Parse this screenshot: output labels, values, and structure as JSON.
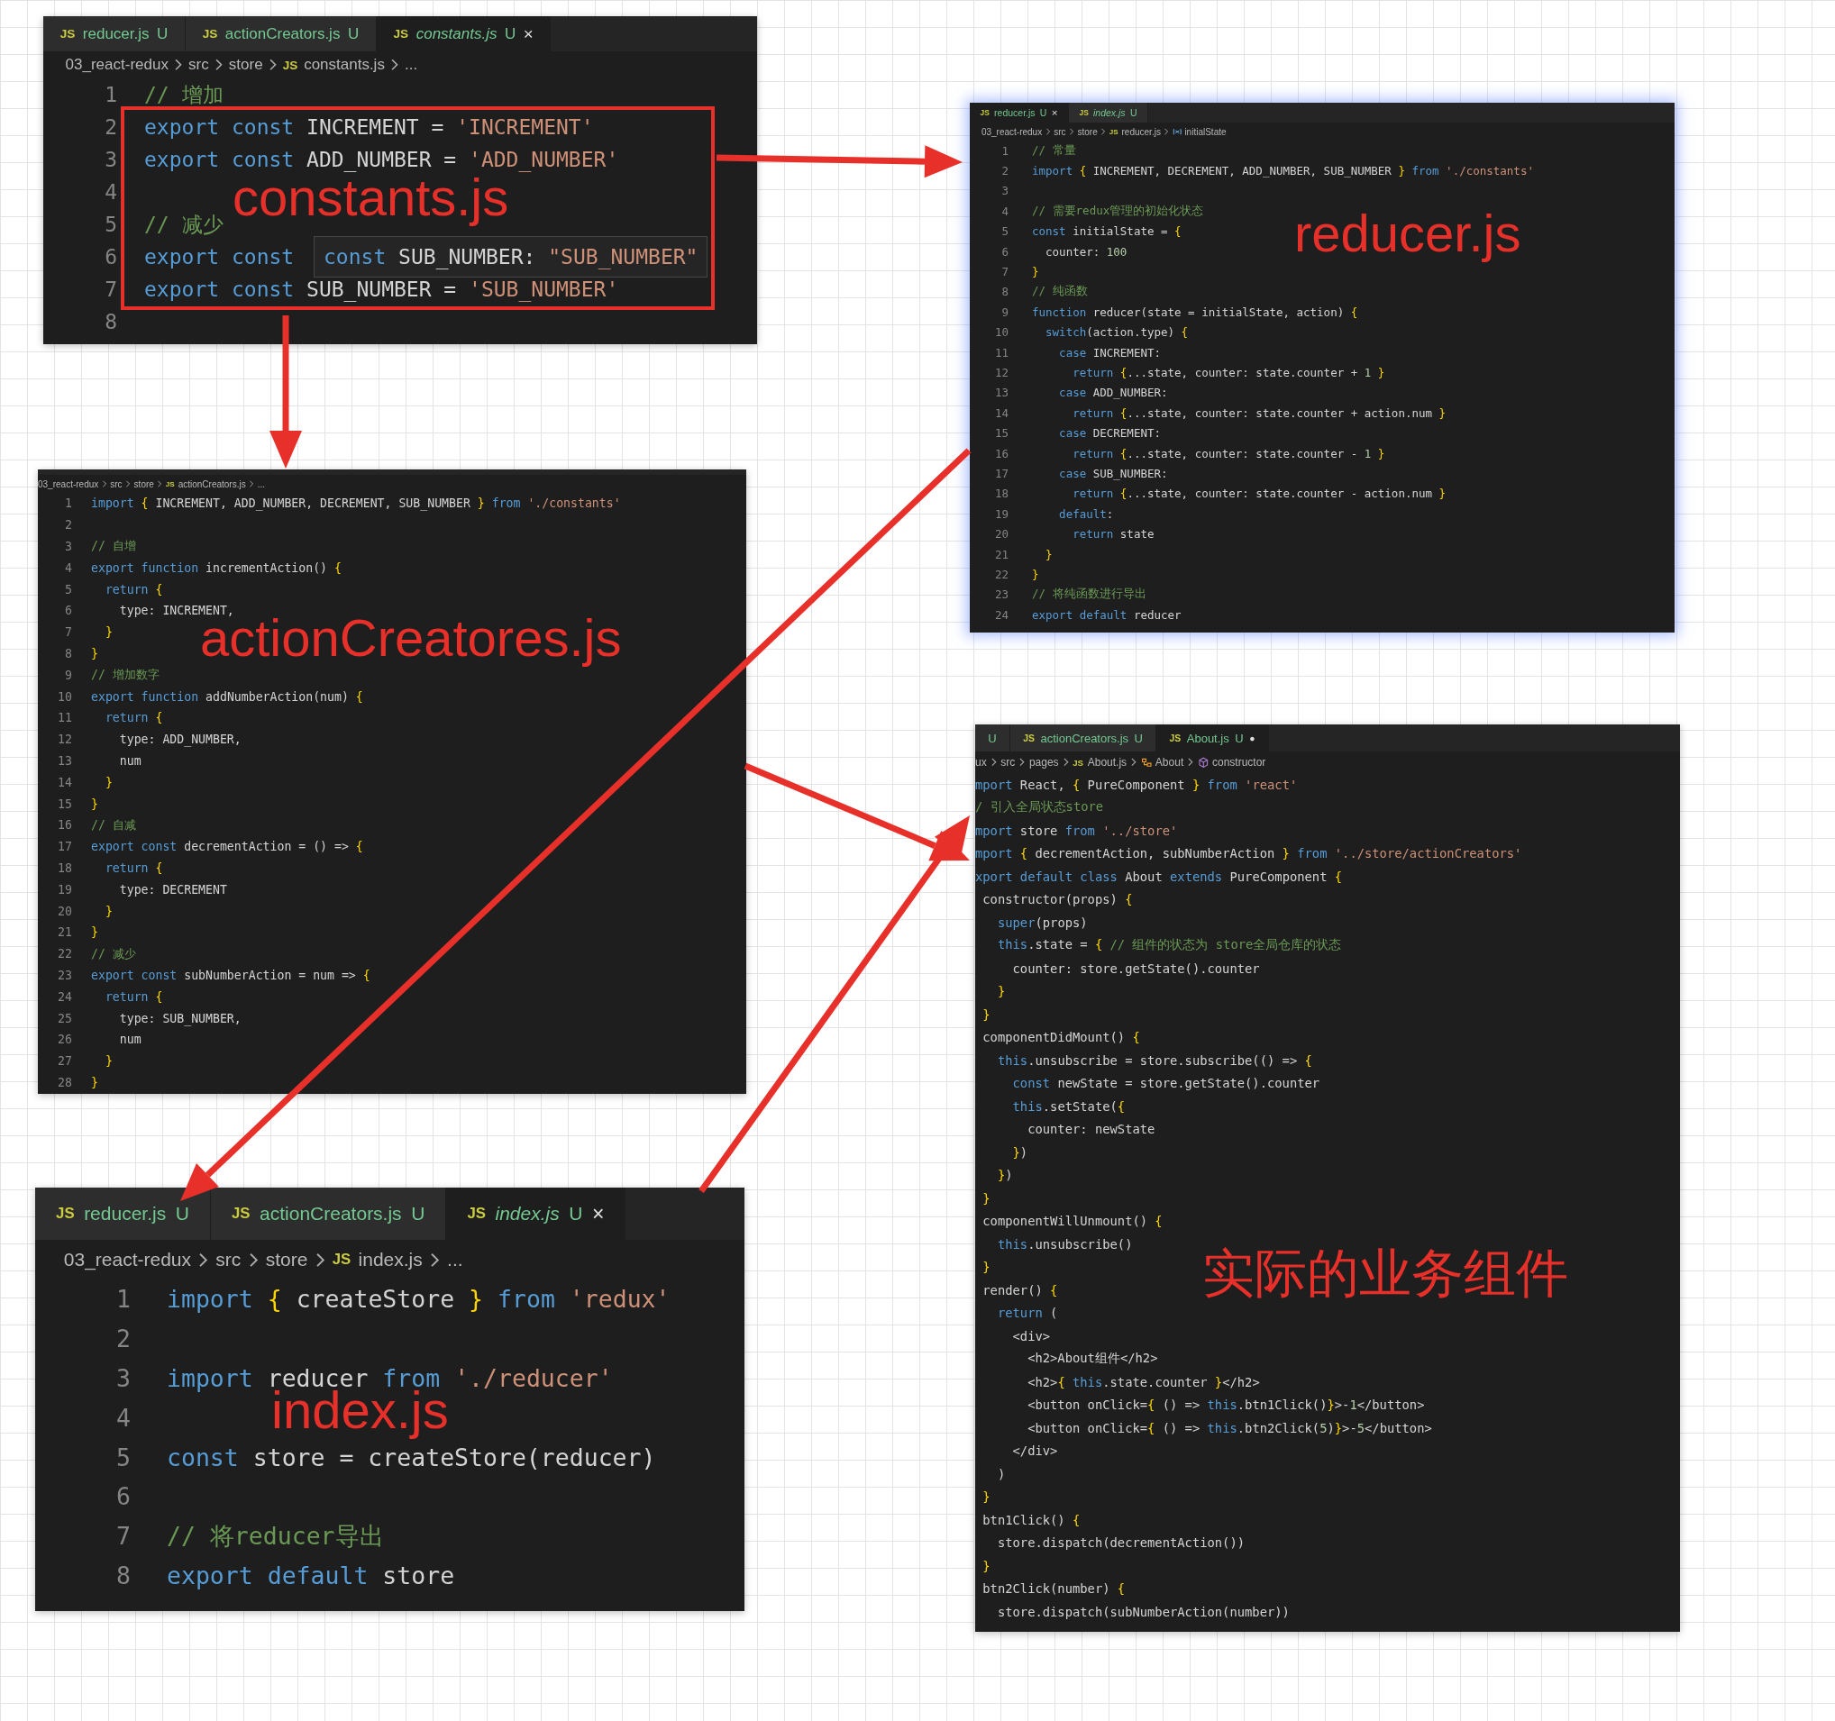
{
  "editors": [
    {
      "tabs": [
        {
          "icon": "JS",
          "label": "reducer.js",
          "badge": "U",
          "selected": false,
          "preview": false
        },
        {
          "icon": "JS",
          "label": "actionCreators.js",
          "badge": "U",
          "selected": false,
          "preview": false
        },
        {
          "icon": "JS",
          "label": "constants.js",
          "badge": "U",
          "close": "×",
          "selected": true,
          "preview": true
        }
      ],
      "breadcrumb": [
        {
          "text": "03_react-redux"
        },
        {
          "text": "src"
        },
        {
          "text": "store"
        },
        {
          "icon": "JS",
          "text": "constants.js"
        },
        {
          "text": "..."
        }
      ],
      "lines": [
        {
          "n": "1",
          "code": "// 增加"
        },
        {
          "n": "2",
          "code": "export const INCREMENT = 'INCREMENT'"
        },
        {
          "n": "3",
          "code": "export const ADD_NUMBER = 'ADD_NUMBER'"
        },
        {
          "n": "4"
        },
        {
          "n": "5",
          "code": "// 减少"
        },
        {
          "n": "6",
          "code": "export const"
        },
        {
          "n": "7",
          "code": "export const SUB_NUMBER = 'SUB_NUMBER'"
        },
        {
          "n": "8"
        }
      ],
      "tooltip": "const SUB_NUMBER: \"SUB_NUMBER\"",
      "annotation": "constants.js"
    },
    {
      "tabs": [
        {
          "icon": "JS",
          "label": "reducer.js",
          "badge": "U",
          "close": "×",
          "selected": true,
          "preview": false
        },
        {
          "icon": "JS",
          "label": "index.js",
          "badge": "U",
          "selected": false,
          "preview": true
        }
      ],
      "breadcrumb": [
        {
          "text": "03_react-redux"
        },
        {
          "text": "src"
        },
        {
          "text": "store"
        },
        {
          "icon": "JS",
          "text": "reducer.js"
        },
        {
          "kind": "variable",
          "text": "initialState"
        }
      ],
      "lines": [
        {
          "n": "1",
          "code": "// 常量"
        },
        {
          "n": "2",
          "code": "import { INCREMENT, DECREMENT, ADD_NUMBER, SUB_NUMBER } from './constants'"
        },
        {
          "n": "3"
        },
        {
          "n": "4",
          "code": "// 需要redux管理的初始化状态"
        },
        {
          "n": "5",
          "code": "const initialState = {"
        },
        {
          "n": "6",
          "code": "  counter: 100"
        },
        {
          "n": "7",
          "code": "}"
        },
        {
          "n": "8",
          "code": "// 纯函数"
        },
        {
          "n": "9",
          "code": "function reducer(state = initialState, action) {"
        },
        {
          "n": "10",
          "code": "  switch(action.type) {"
        },
        {
          "n": "11",
          "code": "    case INCREMENT:"
        },
        {
          "n": "12",
          "code": "      return {...state, counter: state.counter + 1 }"
        },
        {
          "n": "13",
          "code": "    case ADD_NUMBER:"
        },
        {
          "n": "14",
          "code": "      return {...state, counter: state.counter + action.num }"
        },
        {
          "n": "15",
          "code": "    case DECREMENT:"
        },
        {
          "n": "16",
          "code": "      return {...state, counter: state.counter - 1 }"
        },
        {
          "n": "17",
          "code": "    case SUB_NUMBER:"
        },
        {
          "n": "18",
          "code": "      return {...state, counter: state.counter - action.num }"
        },
        {
          "n": "19",
          "code": "    default:"
        },
        {
          "n": "20",
          "code": "      return state"
        },
        {
          "n": "21",
          "code": "  }"
        },
        {
          "n": "22",
          "code": "}"
        },
        {
          "n": "23",
          "code": "// 将纯函数进行导出"
        },
        {
          "n": "24",
          "code": "export default reducer"
        }
      ],
      "annotation": "reducer.js"
    },
    {
      "breadcrumb": [
        {
          "text": "03_react-redux"
        },
        {
          "text": "src"
        },
        {
          "text": "store"
        },
        {
          "icon": "JS",
          "text": "actionCreators.js"
        },
        {
          "text": "..."
        }
      ],
      "lines": [
        {
          "n": "1",
          "code": "import { INCREMENT, ADD_NUMBER, DECREMENT, SUB_NUMBER } from './constants'"
        },
        {
          "n": "2"
        },
        {
          "n": "3",
          "code": "// 自增"
        },
        {
          "n": "4",
          "code": "export function incrementAction() {"
        },
        {
          "n": "5",
          "code": "  return {"
        },
        {
          "n": "6",
          "code": "    type: INCREMENT,"
        },
        {
          "n": "7",
          "code": "  }"
        },
        {
          "n": "8",
          "code": "}"
        },
        {
          "n": "9",
          "code": "// 增加数字"
        },
        {
          "n": "10",
          "code": "export function addNumberAction(num) {"
        },
        {
          "n": "11",
          "code": "  return {"
        },
        {
          "n": "12",
          "code": "    type: ADD_NUMBER,"
        },
        {
          "n": "13",
          "code": "    num"
        },
        {
          "n": "14",
          "code": "  }"
        },
        {
          "n": "15",
          "code": "}"
        },
        {
          "n": "16",
          "code": "// 自减"
        },
        {
          "n": "17",
          "code": "export const decrementAction = () => {"
        },
        {
          "n": "18",
          "code": "  return {"
        },
        {
          "n": "19",
          "code": "    type: DECREMENT"
        },
        {
          "n": "20",
          "code": "  }"
        },
        {
          "n": "21",
          "code": "}"
        },
        {
          "n": "22",
          "code": "// 减少"
        },
        {
          "n": "23",
          "code": "export const subNumberAction = num => {"
        },
        {
          "n": "24",
          "code": "  return {"
        },
        {
          "n": "25",
          "code": "    type: SUB_NUMBER,"
        },
        {
          "n": "26",
          "code": "    num"
        },
        {
          "n": "27",
          "code": "  }"
        },
        {
          "n": "28",
          "code": "}"
        }
      ],
      "annotation": "actionCreatores.js"
    },
    {
      "tabs": [
        {
          "icon": "JS",
          "label": "reducer.js",
          "badge": "U",
          "selected": false,
          "preview": false
        },
        {
          "icon": "JS",
          "label": "actionCreators.js",
          "badge": "U",
          "selected": false,
          "preview": false
        },
        {
          "icon": "JS",
          "label": "index.js",
          "badge": "U",
          "close": "×",
          "selected": true,
          "preview": true
        }
      ],
      "breadcrumb": [
        {
          "text": "03_react-redux"
        },
        {
          "text": "src"
        },
        {
          "text": "store"
        },
        {
          "icon": "JS",
          "text": "index.js"
        },
        {
          "text": "..."
        }
      ],
      "lines": [
        {
          "n": "1",
          "code": "import { createStore } from 'redux'"
        },
        {
          "n": "2"
        },
        {
          "n": "3",
          "code": "import reducer from './reducer'"
        },
        {
          "n": "4"
        },
        {
          "n": "5",
          "code": "const store = createStore(reducer)"
        },
        {
          "n": "6"
        },
        {
          "n": "7",
          "code": "// 将reducer导出"
        },
        {
          "n": "8",
          "code": "export default store"
        }
      ],
      "annotation": "index.js"
    },
    {
      "tabs": [
        {
          "badge": "U",
          "selected": false
        },
        {
          "icon": "JS",
          "label": "actionCreators.js",
          "badge": "U",
          "selected": false,
          "preview": false
        },
        {
          "icon": "JS",
          "label": "About.js",
          "badge": "U",
          "dirty": "●",
          "selected": true,
          "preview": false
        }
      ],
      "breadcrumb": [
        {
          "text": "ux"
        },
        {
          "text": "src"
        },
        {
          "text": "pages"
        },
        {
          "icon": "JS",
          "text": "About.js"
        },
        {
          "kind": "component",
          "text": "About"
        },
        {
          "kind": "method",
          "text": "constructor"
        }
      ],
      "lines": [
        {
          "code": "mport React, { PureComponent } from 'react'"
        },
        {
          "code": "/ 引入全局状态store"
        },
        {
          "code": "mport store from '../store'"
        },
        {
          "code": "mport { decrementAction, subNumberAction } from '../store/actionCreators'"
        },
        {
          "code": "xport default class About extends PureComponent {"
        },
        {
          "code": " constructor(props) {"
        },
        {
          "code": "   super(props)"
        },
        {
          "code": "   this.state = { // 组件的状态为 store全局仓库的状态"
        },
        {
          "code": "     counter: store.getState().counter"
        },
        {
          "code": "   }"
        },
        {
          "code": " }"
        },
        {
          "code": " componentDidMount() {"
        },
        {
          "code": "   this.unsubscribe = store.subscribe(() => {"
        },
        {
          "code": "     const newState = store.getState().counter"
        },
        {
          "code": "     this.setState({"
        },
        {
          "code": "       counter: newState"
        },
        {
          "code": "     })"
        },
        {
          "code": "   })"
        },
        {
          "code": " }"
        },
        {
          "code": " componentWillUnmount() {"
        },
        {
          "code": "   this.unsubscribe()"
        },
        {
          "code": " }"
        },
        {
          "code": " render() {"
        },
        {
          "code": "   return ("
        },
        {
          "code": "     <div>"
        },
        {
          "code": "       <h2>About组件</h2>"
        },
        {
          "code": "       <h2>{ this.state.counter }</h2>"
        },
        {
          "code": "       <button onClick={ () => this.btn1Click()}>-1</button>"
        },
        {
          "code": "       <button onClick={ () => this.btn2Click(5)}>-5</button>"
        },
        {
          "code": "     </div>"
        },
        {
          "code": "   )"
        },
        {
          "code": " }"
        },
        {
          "code": " btn1Click() {"
        },
        {
          "code": "   store.dispatch(decrementAction())"
        },
        {
          "code": " }"
        },
        {
          "code": " btn2Click(number) {"
        },
        {
          "code": "   store.dispatch(subNumberAction(number))"
        }
      ],
      "annotation": "实际的业务组件"
    }
  ]
}
